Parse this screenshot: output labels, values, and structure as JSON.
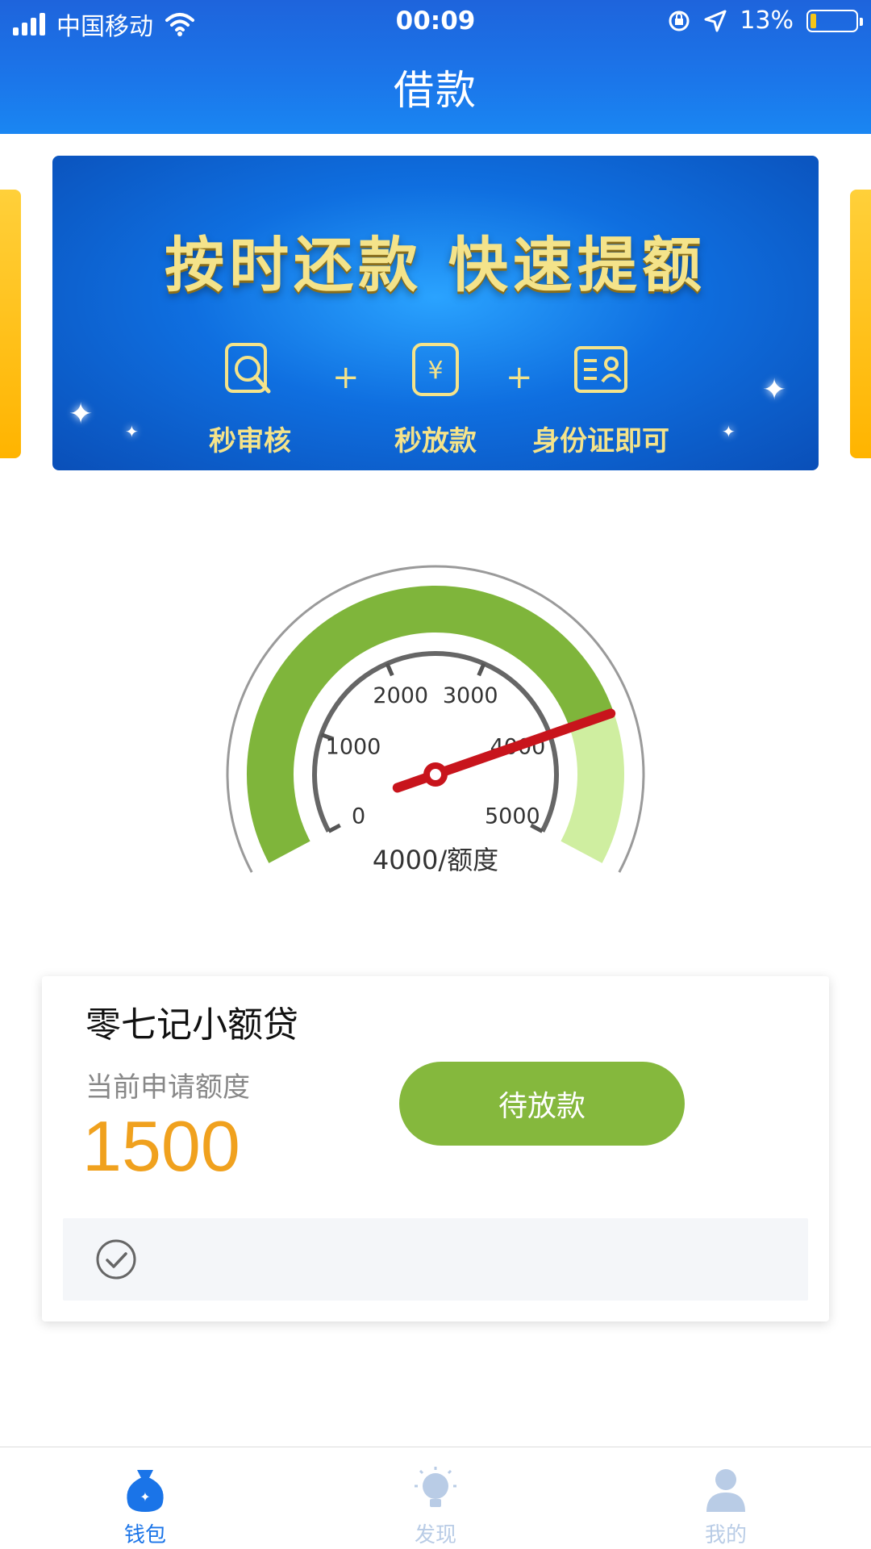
{
  "status_bar": {
    "carrier": "中国移动",
    "time": "00:09",
    "battery_percent": "13%",
    "battery_level": 0.13
  },
  "header": {
    "title": "借款"
  },
  "banner": {
    "headline": "按时还款  快速提额",
    "features": [
      {
        "label": "秒审核",
        "icon": "magnifier-doc-icon"
      },
      {
        "label": "秒放款",
        "icon": "yuan-doc-icon"
      },
      {
        "label": "身份证即可",
        "icon": "id-card-icon"
      }
    ],
    "plus": "+"
  },
  "gauge": {
    "ticks": [
      "0",
      "1000",
      "2000",
      "3000",
      "4000",
      "5000"
    ],
    "min": 0,
    "max": 5000,
    "value": 4000,
    "caption": "4000/额度",
    "colors": {
      "filled": "#7fb53b",
      "remaining": "#cfeea0",
      "needle": "#c8141c"
    }
  },
  "loan_card": {
    "product_name": "零七记小额贷",
    "amount_label": "当前申请额度",
    "amount": "1500",
    "status_label": "待放款",
    "colors": {
      "amount": "#f0a11e",
      "button": "#85b83d"
    }
  },
  "tabbar": {
    "items": [
      {
        "label": "钱包",
        "icon": "wallet-bag-icon",
        "active": true
      },
      {
        "label": "发现",
        "icon": "lightbulb-icon",
        "active": false
      },
      {
        "label": "我的",
        "icon": "person-icon",
        "active": false
      }
    ],
    "active_color": "#1a74e8"
  }
}
